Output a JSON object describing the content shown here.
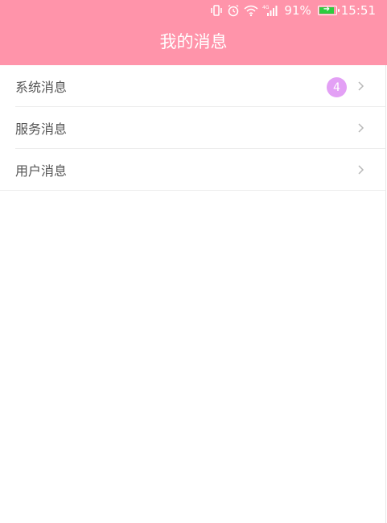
{
  "status_bar": {
    "battery_percent": "91%",
    "time": "15:51",
    "network": "4G",
    "icons": [
      "vibrate-icon",
      "alarm-icon",
      "wifi-icon",
      "signal-icon",
      "battery-icon"
    ]
  },
  "header": {
    "title": "我的消息",
    "background_color": "#ff94aa"
  },
  "list": {
    "items": [
      {
        "label": "系统消息",
        "badge": "4"
      },
      {
        "label": "服务消息"
      },
      {
        "label": "用户消息"
      }
    ]
  },
  "colors": {
    "badge": "#e3a0f5",
    "text": "#555555"
  }
}
